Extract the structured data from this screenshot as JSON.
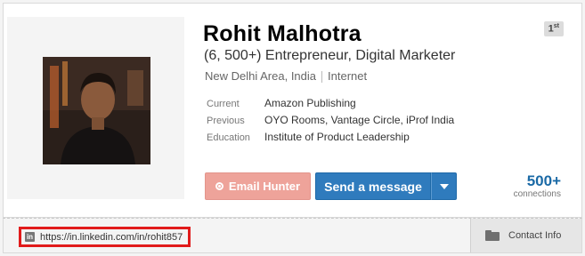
{
  "profile": {
    "name": "Rohit Malhotra",
    "headline": "(6, 500+) Entrepreneur, Digital Marketer",
    "location": "New Delhi Area, India",
    "industry": "Internet",
    "degree": "1",
    "degree_suffix": "st",
    "details": [
      {
        "key": "Current",
        "value": "Amazon Publishing"
      },
      {
        "key": "Previous",
        "value": "OYO Rooms, Vantage Circle, iProf India"
      },
      {
        "key": "Education",
        "value": "Institute of Product Leadership"
      }
    ]
  },
  "actions": {
    "email_hunter_label": "Email Hunter",
    "send_message_label": "Send a message"
  },
  "connections": {
    "count": "500+",
    "label": "connections"
  },
  "footer": {
    "url": "https://in.linkedin.com/in/rohit857",
    "linkedin_icon_text": "in",
    "contact_info_label": "Contact Info"
  },
  "colors": {
    "email_button": "#eea39a",
    "message_button": "#2f7bbd",
    "connections_accent": "#1b6aa6",
    "highlight_border": "#e11b1b"
  },
  "icons": [
    "target-icon",
    "chevron-down-icon",
    "linkedin-icon",
    "folder-icon"
  ]
}
